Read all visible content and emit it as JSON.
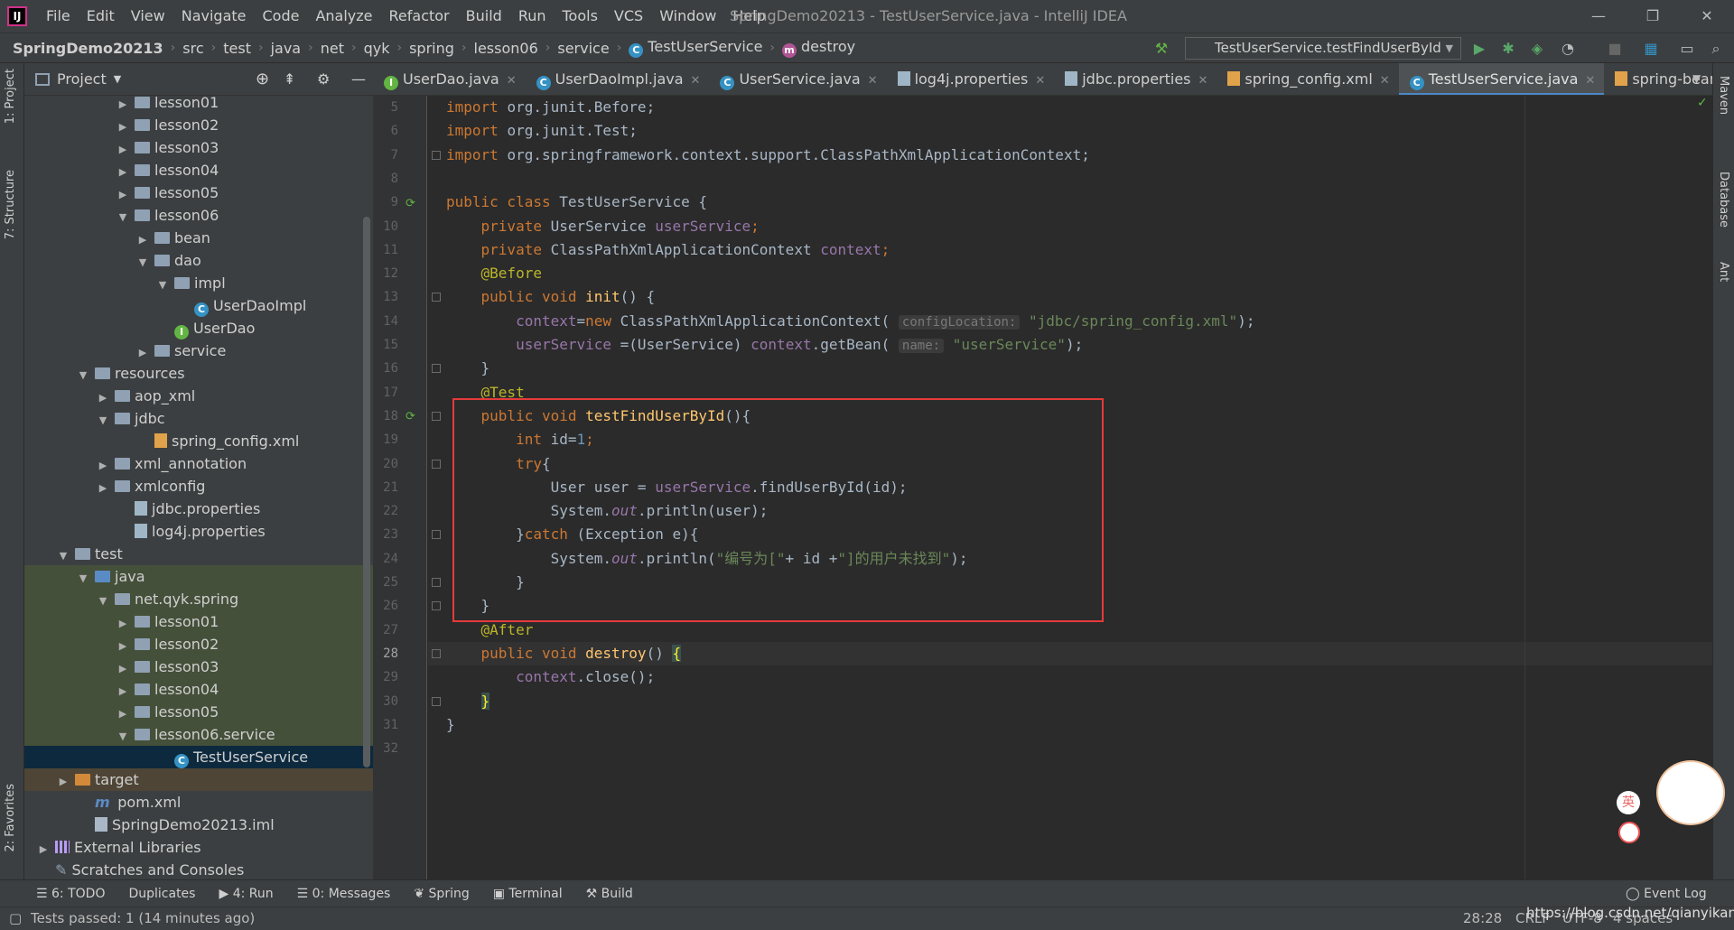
{
  "menubar": {
    "items": [
      "File",
      "Edit",
      "View",
      "Navigate",
      "Code",
      "Analyze",
      "Refactor",
      "Build",
      "Run",
      "Tools",
      "VCS",
      "Window",
      "Help"
    ],
    "window_title": "SpringDemo20213 - TestUserService.java - IntelliJ IDEA",
    "logo": "IJ"
  },
  "navbar": {
    "crumbs": [
      "SpringDemo20213",
      "src",
      "test",
      "java",
      "net",
      "qyk",
      "spring",
      "lesson06",
      "service",
      "TestUserService",
      "destroy"
    ],
    "run_config": "TestUserService.testFindUserById"
  },
  "left_strip": {
    "project": "1: Project",
    "structure": "7: Structure",
    "favorites": "2: Favorites"
  },
  "right_strip": {
    "maven": "Maven",
    "database": "Database",
    "ant": "Ant"
  },
  "project_panel": {
    "title": "Project",
    "tree": [
      {
        "label": "lesson01",
        "depth": 5,
        "arrow": "right",
        "icon": "folder"
      },
      {
        "label": "lesson02",
        "depth": 5,
        "arrow": "right",
        "icon": "folder"
      },
      {
        "label": "lesson03",
        "depth": 5,
        "arrow": "right",
        "icon": "folder"
      },
      {
        "label": "lesson04",
        "depth": 5,
        "arrow": "right",
        "icon": "folder"
      },
      {
        "label": "lesson05",
        "depth": 5,
        "arrow": "right",
        "icon": "folder"
      },
      {
        "label": "lesson06",
        "depth": 5,
        "arrow": "down",
        "icon": "folder"
      },
      {
        "label": "bean",
        "depth": 6,
        "arrow": "right",
        "icon": "folder"
      },
      {
        "label": "dao",
        "depth": 6,
        "arrow": "down",
        "icon": "folder"
      },
      {
        "label": "impl",
        "depth": 7,
        "arrow": "down",
        "icon": "folder"
      },
      {
        "label": "UserDaoImpl",
        "depth": 8,
        "arrow": "",
        "icon": "class"
      },
      {
        "label": "UserDao",
        "depth": 7,
        "arrow": "",
        "icon": "interface"
      },
      {
        "label": "service",
        "depth": 6,
        "arrow": "right",
        "icon": "folder"
      },
      {
        "label": "resources",
        "depth": 3,
        "arrow": "down",
        "icon": "folder"
      },
      {
        "label": "aop_xml",
        "depth": 4,
        "arrow": "right",
        "icon": "folder"
      },
      {
        "label": "jdbc",
        "depth": 4,
        "arrow": "down",
        "icon": "folder"
      },
      {
        "label": "spring_config.xml",
        "depth": 6,
        "arrow": "",
        "icon": "xml"
      },
      {
        "label": "xml_annotation",
        "depth": 4,
        "arrow": "right",
        "icon": "folder"
      },
      {
        "label": "xmlconfig",
        "depth": 4,
        "arrow": "right",
        "icon": "folder"
      },
      {
        "label": "jdbc.properties",
        "depth": 5,
        "arrow": "",
        "icon": "props"
      },
      {
        "label": "log4j.properties",
        "depth": 5,
        "arrow": "",
        "icon": "props"
      },
      {
        "label": "test",
        "depth": 2,
        "arrow": "down",
        "icon": "folder"
      },
      {
        "label": "java",
        "depth": 3,
        "arrow": "down",
        "icon": "folder-green",
        "hl": "green"
      },
      {
        "label": "net.qyk.spring",
        "depth": 4,
        "arrow": "down",
        "icon": "folder",
        "hl": "green"
      },
      {
        "label": "lesson01",
        "depth": 5,
        "arrow": "right",
        "icon": "folder",
        "hl": "green"
      },
      {
        "label": "lesson02",
        "depth": 5,
        "arrow": "right",
        "icon": "folder",
        "hl": "green"
      },
      {
        "label": "lesson03",
        "depth": 5,
        "arrow": "right",
        "icon": "folder",
        "hl": "green"
      },
      {
        "label": "lesson04",
        "depth": 5,
        "arrow": "right",
        "icon": "folder",
        "hl": "green"
      },
      {
        "label": "lesson05",
        "depth": 5,
        "arrow": "right",
        "icon": "folder",
        "hl": "green"
      },
      {
        "label": "lesson06.service",
        "depth": 5,
        "arrow": "down",
        "icon": "folder",
        "hl": "green"
      },
      {
        "label": "TestUserService",
        "depth": 7,
        "arrow": "",
        "icon": "class",
        "hl": "selected"
      },
      {
        "label": "target",
        "depth": 2,
        "arrow": "right",
        "icon": "folder-brown",
        "hl": "brown"
      },
      {
        "label": "pom.xml",
        "depth": 3,
        "arrow": "",
        "icon": "maven"
      },
      {
        "label": "SpringDemo20213.iml",
        "depth": 3,
        "arrow": "",
        "icon": "file"
      },
      {
        "label": "External Libraries",
        "depth": 1,
        "arrow": "right",
        "icon": "lib"
      },
      {
        "label": "Scratches and Consoles",
        "depth": 1,
        "arrow": "",
        "icon": "scratch"
      }
    ]
  },
  "tabs": [
    {
      "label": "UserDao.java",
      "icon": "I",
      "active": false
    },
    {
      "label": "UserDaoImpl.java",
      "icon": "C",
      "active": false
    },
    {
      "label": "UserService.java",
      "icon": "C",
      "active": false
    },
    {
      "label": "log4j.properties",
      "icon": "P",
      "active": false
    },
    {
      "label": "jdbc.properties",
      "icon": "P",
      "active": false
    },
    {
      "label": "spring_config.xml",
      "icon": "X",
      "active": false
    },
    {
      "label": "TestUserService.java",
      "icon": "C",
      "active": true
    },
    {
      "label": "spring-bean",
      "icon": "X",
      "active": false
    }
  ],
  "editor": {
    "line_numbers": [
      "5",
      "6",
      "7",
      "8",
      "9",
      "10",
      "11",
      "12",
      "13",
      "14",
      "15",
      "16",
      "17",
      "18",
      "19",
      "20",
      "21",
      "22",
      "23",
      "24",
      "25",
      "26",
      "27",
      "28",
      "29",
      "30",
      "31",
      "32"
    ],
    "current_line": "28",
    "code": [
      [
        [
          "kw",
          "import "
        ],
        [
          "",
          "org.junit.Before;"
        ]
      ],
      [
        [
          "kw",
          "import "
        ],
        [
          "",
          "org.junit.Test;"
        ]
      ],
      [
        [
          "kw",
          "import "
        ],
        [
          "",
          "org.springframework.context.support.ClassPathXmlApplicationContext;"
        ]
      ],
      [],
      [
        [
          "kw",
          "public class "
        ],
        [
          "",
          "TestUserService {"
        ]
      ],
      [
        [
          "",
          "    "
        ],
        [
          "kw",
          "private "
        ],
        [
          "",
          "UserService "
        ],
        [
          "fld",
          "userService"
        ],
        [
          "kw",
          ";"
        ]
      ],
      [
        [
          "",
          "    "
        ],
        [
          "kw",
          "private "
        ],
        [
          "",
          "ClassPathXmlApplicationContext "
        ],
        [
          "fld",
          "context"
        ],
        [
          "kw",
          ";"
        ]
      ],
      [
        [
          "",
          "    "
        ],
        [
          "ann",
          "@Before"
        ]
      ],
      [
        [
          "",
          "    "
        ],
        [
          "kw",
          "public void "
        ],
        [
          "fn",
          "init"
        ],
        [
          "",
          "() {"
        ]
      ],
      [
        [
          "",
          "        "
        ],
        [
          "fld",
          "context"
        ],
        [
          "",
          "="
        ],
        [
          "kw",
          "new "
        ],
        [
          "",
          "ClassPathXmlApplicationContext( "
        ],
        [
          "hint",
          "configLocation:"
        ],
        [
          "str",
          " \"jdbc/spring_config.xml\""
        ],
        [
          "",
          ");"
        ]
      ],
      [
        [
          "",
          "        "
        ],
        [
          "fld",
          "userService"
        ],
        [
          "",
          " =(UserService) "
        ],
        [
          "fld",
          "context"
        ],
        [
          "",
          ".getBean( "
        ],
        [
          "hint",
          "name:"
        ],
        [
          "str",
          " \"userService\""
        ],
        [
          "",
          ");"
        ]
      ],
      [
        [
          "",
          "    }"
        ]
      ],
      [
        [
          "",
          "    "
        ],
        [
          "ann",
          "@Test"
        ]
      ],
      [
        [
          "",
          "    "
        ],
        [
          "kw",
          "public void "
        ],
        [
          "fn",
          "testFindUserById"
        ],
        [
          "",
          "(){"
        ]
      ],
      [
        [
          "",
          "        "
        ],
        [
          "kw",
          "int "
        ],
        [
          "",
          "id="
        ],
        [
          "num",
          "1"
        ],
        [
          "kw",
          ";"
        ]
      ],
      [
        [
          "",
          "        "
        ],
        [
          "kw",
          "try"
        ],
        [
          "",
          "{"
        ]
      ],
      [
        [
          "",
          "            User user = "
        ],
        [
          "fld",
          "userService"
        ],
        [
          "",
          ".findUserById(id);"
        ]
      ],
      [
        [
          "",
          "            System."
        ],
        [
          "ital",
          "out"
        ],
        [
          "",
          ".println(user);"
        ]
      ],
      [
        [
          "",
          "        }"
        ],
        [
          "kw",
          "catch "
        ],
        [
          "",
          "(Exception e){"
        ]
      ],
      [
        [
          "",
          "            System."
        ],
        [
          "ital",
          "out"
        ],
        [
          "",
          ".println("
        ],
        [
          "str",
          "\"编号为[\""
        ],
        [
          "",
          "+ id +"
        ],
        [
          "str",
          "\"]的用户未找到\""
        ],
        [
          "",
          ");"
        ]
      ],
      [
        [
          "",
          "        }"
        ]
      ],
      [
        [
          "",
          "    }"
        ]
      ],
      [
        [
          "",
          "    "
        ],
        [
          "ann",
          "@After"
        ]
      ],
      [
        [
          "",
          "    "
        ],
        [
          "kw",
          "public void "
        ],
        [
          "fn",
          "destroy"
        ],
        [
          "",
          "() "
        ],
        [
          "brace",
          "{"
        ]
      ],
      [
        [
          "",
          "        "
        ],
        [
          "fld",
          "context"
        ],
        [
          "",
          ".close();"
        ]
      ],
      [
        [
          "",
          "    "
        ],
        [
          "brace",
          "}"
        ]
      ],
      [
        [
          "",
          "}"
        ]
      ],
      []
    ]
  },
  "bottom_tabs": [
    "6: TODO",
    "Duplicates",
    "4: Run",
    "0: Messages",
    "Spring",
    "Terminal",
    "Build"
  ],
  "event_log": "Event Log",
  "status": {
    "message": "Tests passed: 1 (14 minutes ago)",
    "position": "28:28",
    "line_sep": "CRLF",
    "encoding": "UTF-8",
    "indent": "4 spaces",
    "watermark": "https://blog.csdn.net/qianyikang"
  },
  "colors": {
    "accent": "#4a88c7",
    "highlight_box": "#e63a3a",
    "keyword": "#cc7832"
  }
}
